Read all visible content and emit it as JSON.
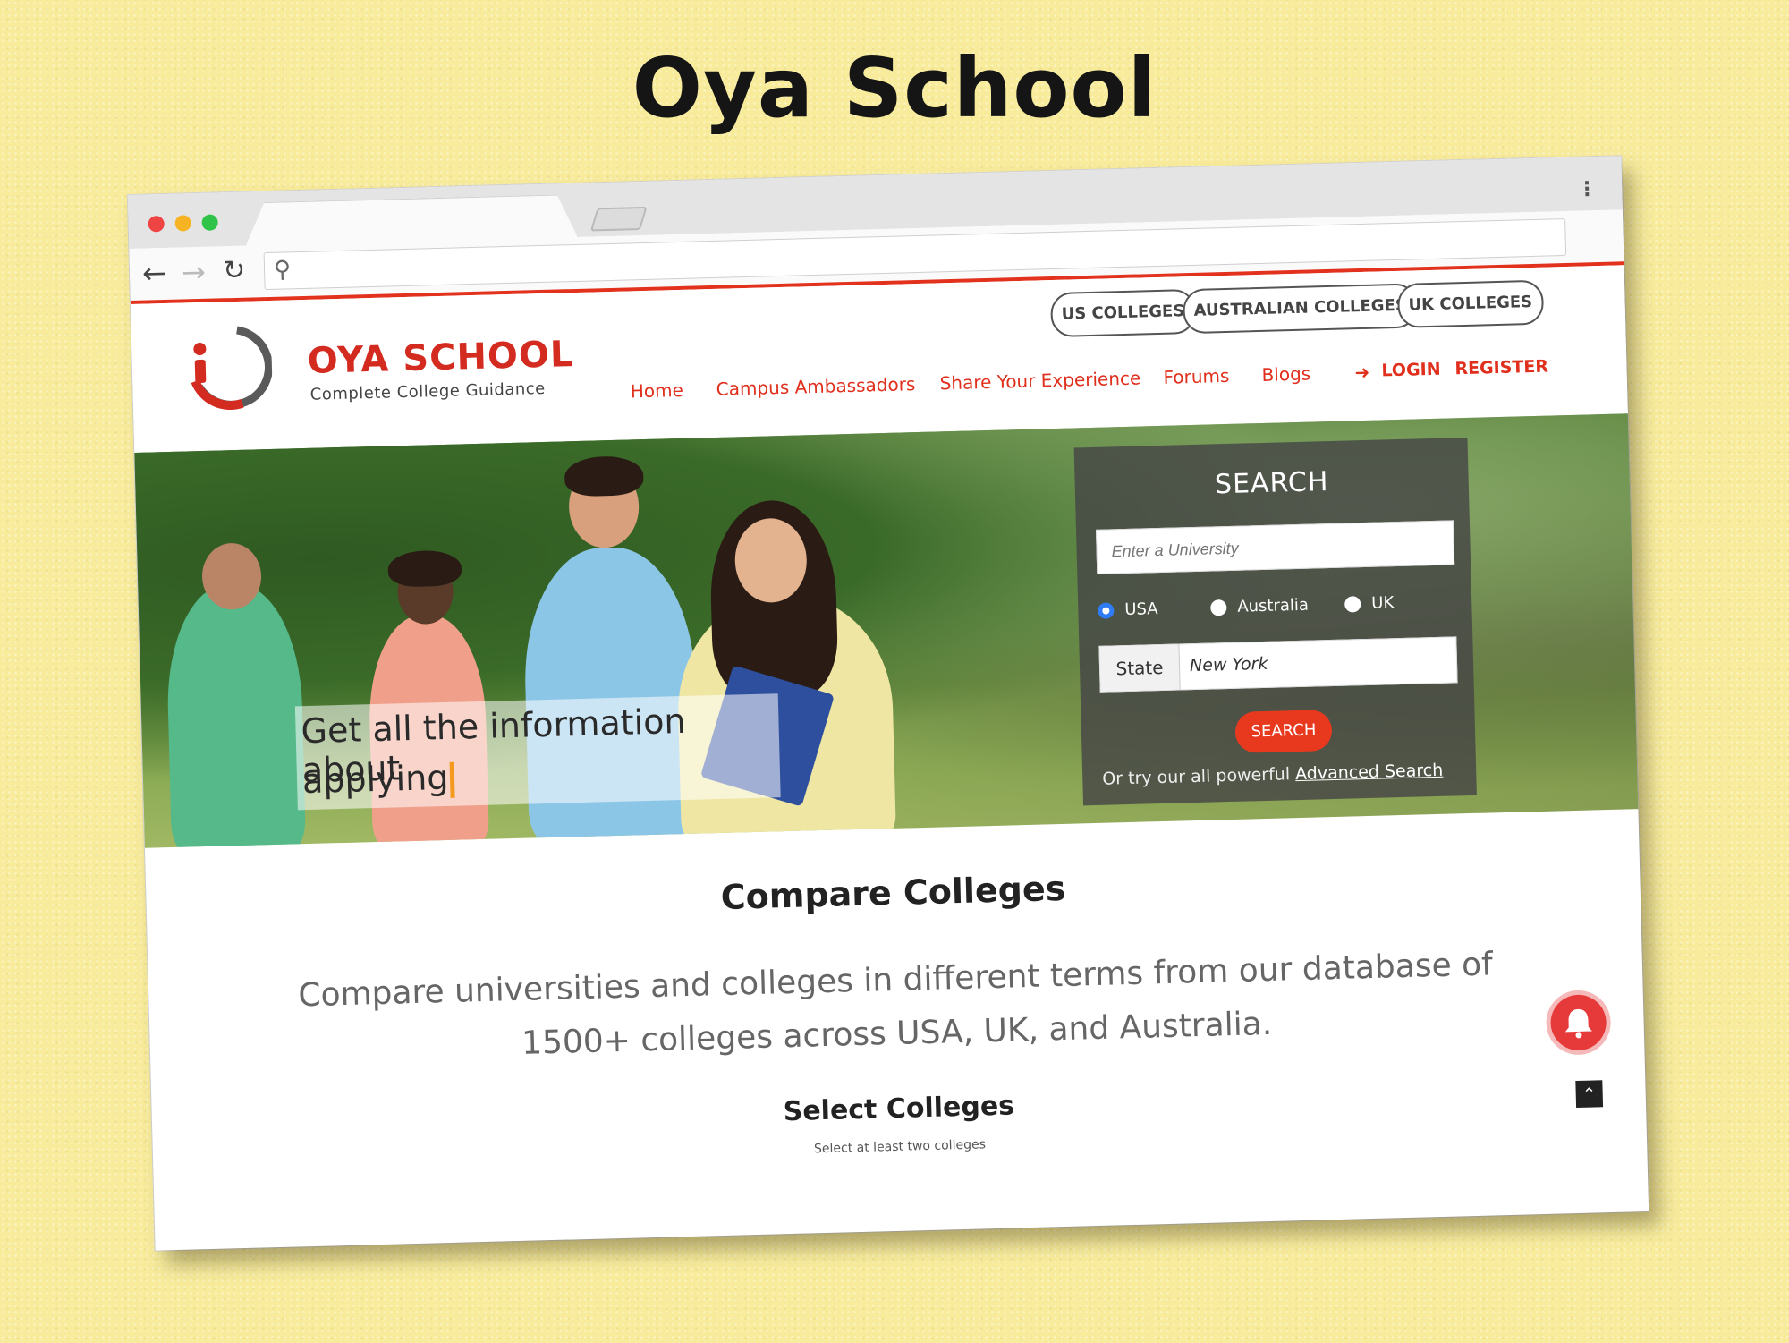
{
  "page_title": "Oya School",
  "browser": {
    "address_value": "",
    "icons": [
      "back-arrow-icon",
      "forward-arrow-icon",
      "reload-icon",
      "search-icon",
      "kebab-menu-icon"
    ]
  },
  "site": {
    "brand": "OYA SCHOOL",
    "tagline": "Complete College Guidance",
    "country_buttons": [
      "US COLLEGES",
      "AUSTRALIAN COLLEGES",
      "UK COLLEGES"
    ],
    "menu": [
      "Home",
      "Campus Ambassadors",
      "Share Your Experience",
      "Forums",
      "Blogs"
    ],
    "login": "LOGIN",
    "register": "REGISTER",
    "accent_color": "#e0301d"
  },
  "hero": {
    "caption_line1": "Get all the information about",
    "caption_line2": "applying"
  },
  "search": {
    "title": "SEARCH",
    "placeholder": "Enter a University",
    "countries": [
      "USA",
      "Australia",
      "UK"
    ],
    "selected_country": "USA",
    "state_label": "State",
    "state_value": "New York",
    "button": "SEARCH",
    "footer_prefix": "Or try our all powerful ",
    "footer_link": "Advanced Search"
  },
  "compare": {
    "title": "Compare Colleges",
    "description": "Compare universities and colleges in different terms from our database of 1500+ colleges across USA, UK, and Australia.",
    "select_title": "Select Colleges",
    "select_subtitle": "Select at least two colleges"
  }
}
